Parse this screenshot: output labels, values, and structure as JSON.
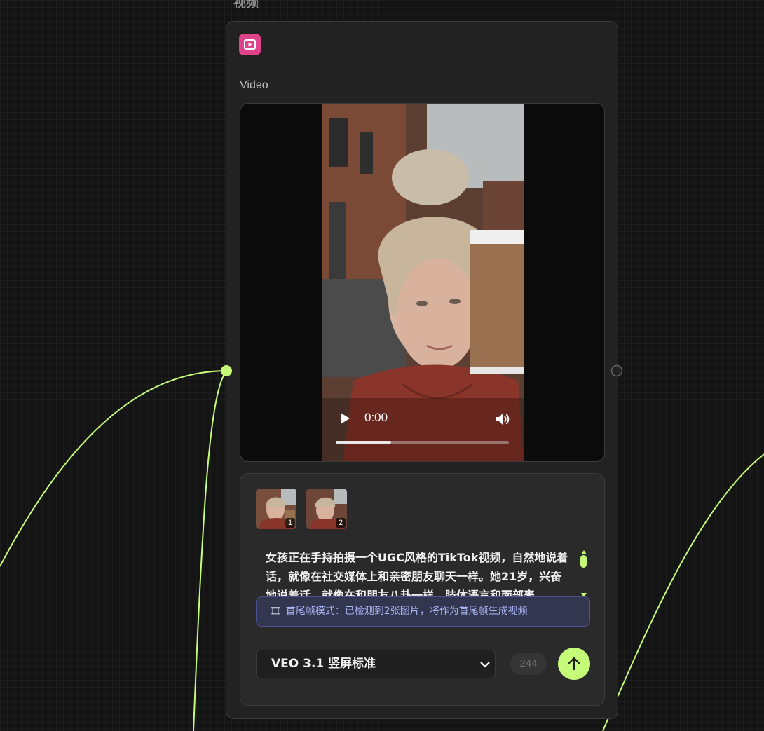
{
  "node": {
    "title": "视频",
    "section_label": "Video",
    "type_icon": "video-play-icon"
  },
  "colors": {
    "accent": "#c6fb7a",
    "node_icon": "#e0428c",
    "notice_bg": "#33364f",
    "notice_text": "#a9b4f5"
  },
  "player": {
    "time": "0:00",
    "progress_fraction": 0.32
  },
  "prompt": {
    "thumbnails": [
      {
        "badge": "1"
      },
      {
        "badge": "2"
      }
    ],
    "text": "女孩正在手持拍摄一个UGC风格的TikTok视频，自然地说着话，就像在社交媒体上和亲密朋友聊天一样。她21岁，兴奋地说着话，就像在和朋友八卦一样，肢体语言和面部表",
    "notice_icon": "🎞",
    "notice": "首尾帧模式：已检测到2张图片，将作为首尾帧生成视频",
    "model": "VEO 3.1 竖屏标准",
    "char_count": "244"
  }
}
